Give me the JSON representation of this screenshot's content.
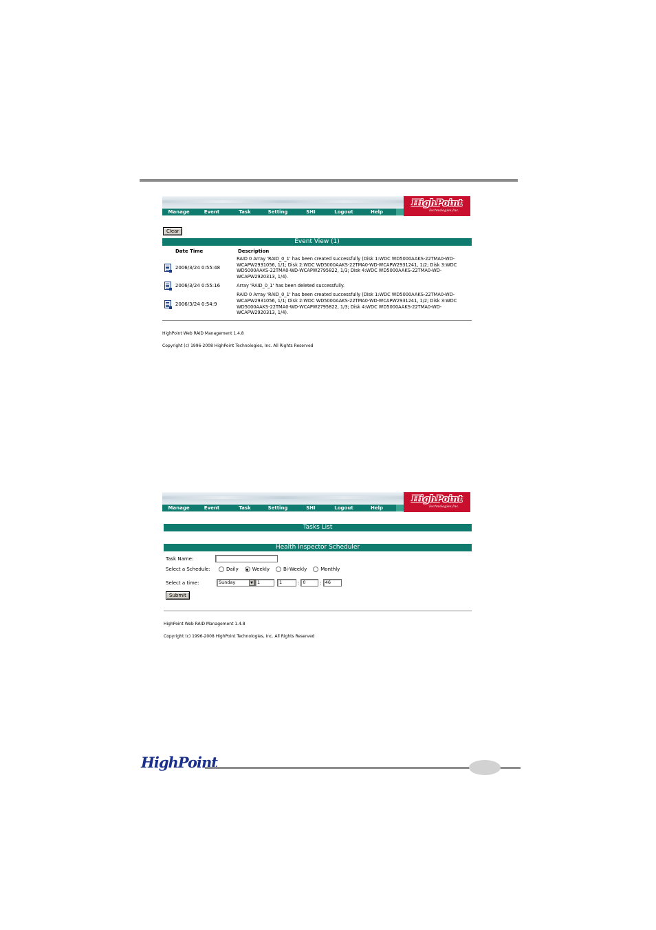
{
  "logo": {
    "main": "HighPoint",
    "sub": "Technologies,Inc."
  },
  "nav": [
    "Manage",
    "Event",
    "Task",
    "Setting",
    "SHI",
    "Logout",
    "Help"
  ],
  "event_view": {
    "clear_label": "Clear",
    "title": "Event View (1)",
    "col_date": "Date Time",
    "col_desc": "Description",
    "rows": [
      {
        "date": "2006/3/24 0:55:48",
        "desc": "RAID 0 Array 'RAID_0_1' has been created successfully (Disk 1:WDC WD5000AAKS-22TMA0-WD-WCAPW2931056, 1/1; Disk 2:WDC WD5000AAKS-22TMA0-WD-WCAPW2931241, 1/2; Disk 3:WDC WD5000AAKS-22TMA0-WD-WCAPW2795822, 1/3; Disk 4:WDC WD5000AAKS-22TMA0-WD-WCAPW2920313, 1/4)."
      },
      {
        "date": "2006/3/24 0:55:16",
        "desc": "Array 'RAID_0_1' has been deleted successfully."
      },
      {
        "date": "2006/3/24 0:54:9",
        "desc": "RAID 0 Array 'RAID_0_1' has been created successfully (Disk 1:WDC WD5000AAKS-22TMA0-WD-WCAPW2931056, 1/1; Disk 2:WDC WD5000AAKS-22TMA0-WD-WCAPW2931241, 1/2; Disk 3:WDC WD5000AAKS-22TMA0-WD-WCAPW2795822, 1/3; Disk 4:WDC WD5000AAKS-22TMA0-WD-WCAPW2920313, 1/4)."
      }
    ]
  },
  "footer": {
    "version": "HighPoint Web RAID Management 1.4.8",
    "copyright": "Copyright (c) 1996-2008 HighPoint Technologies, Inc. All Rights Reserved"
  },
  "tasks": {
    "list_title": "Tasks List",
    "scheduler_title": "Health Inspector Scheduler",
    "task_name_label": "Task Name:",
    "task_name_value": "",
    "schedule_label": "Select a Schedule:",
    "schedule_options": [
      "Daily",
      "Weekly",
      "Bi-Weekly",
      "Monthly"
    ],
    "schedule_selected": "Weekly",
    "time_label": "Select a time:",
    "day_value": "Sunday",
    "field1": "1",
    "field2": "1",
    "hour": "0",
    "minute": "46",
    "submit_label": "Submit"
  },
  "page_footer_logo": "HighPoint"
}
